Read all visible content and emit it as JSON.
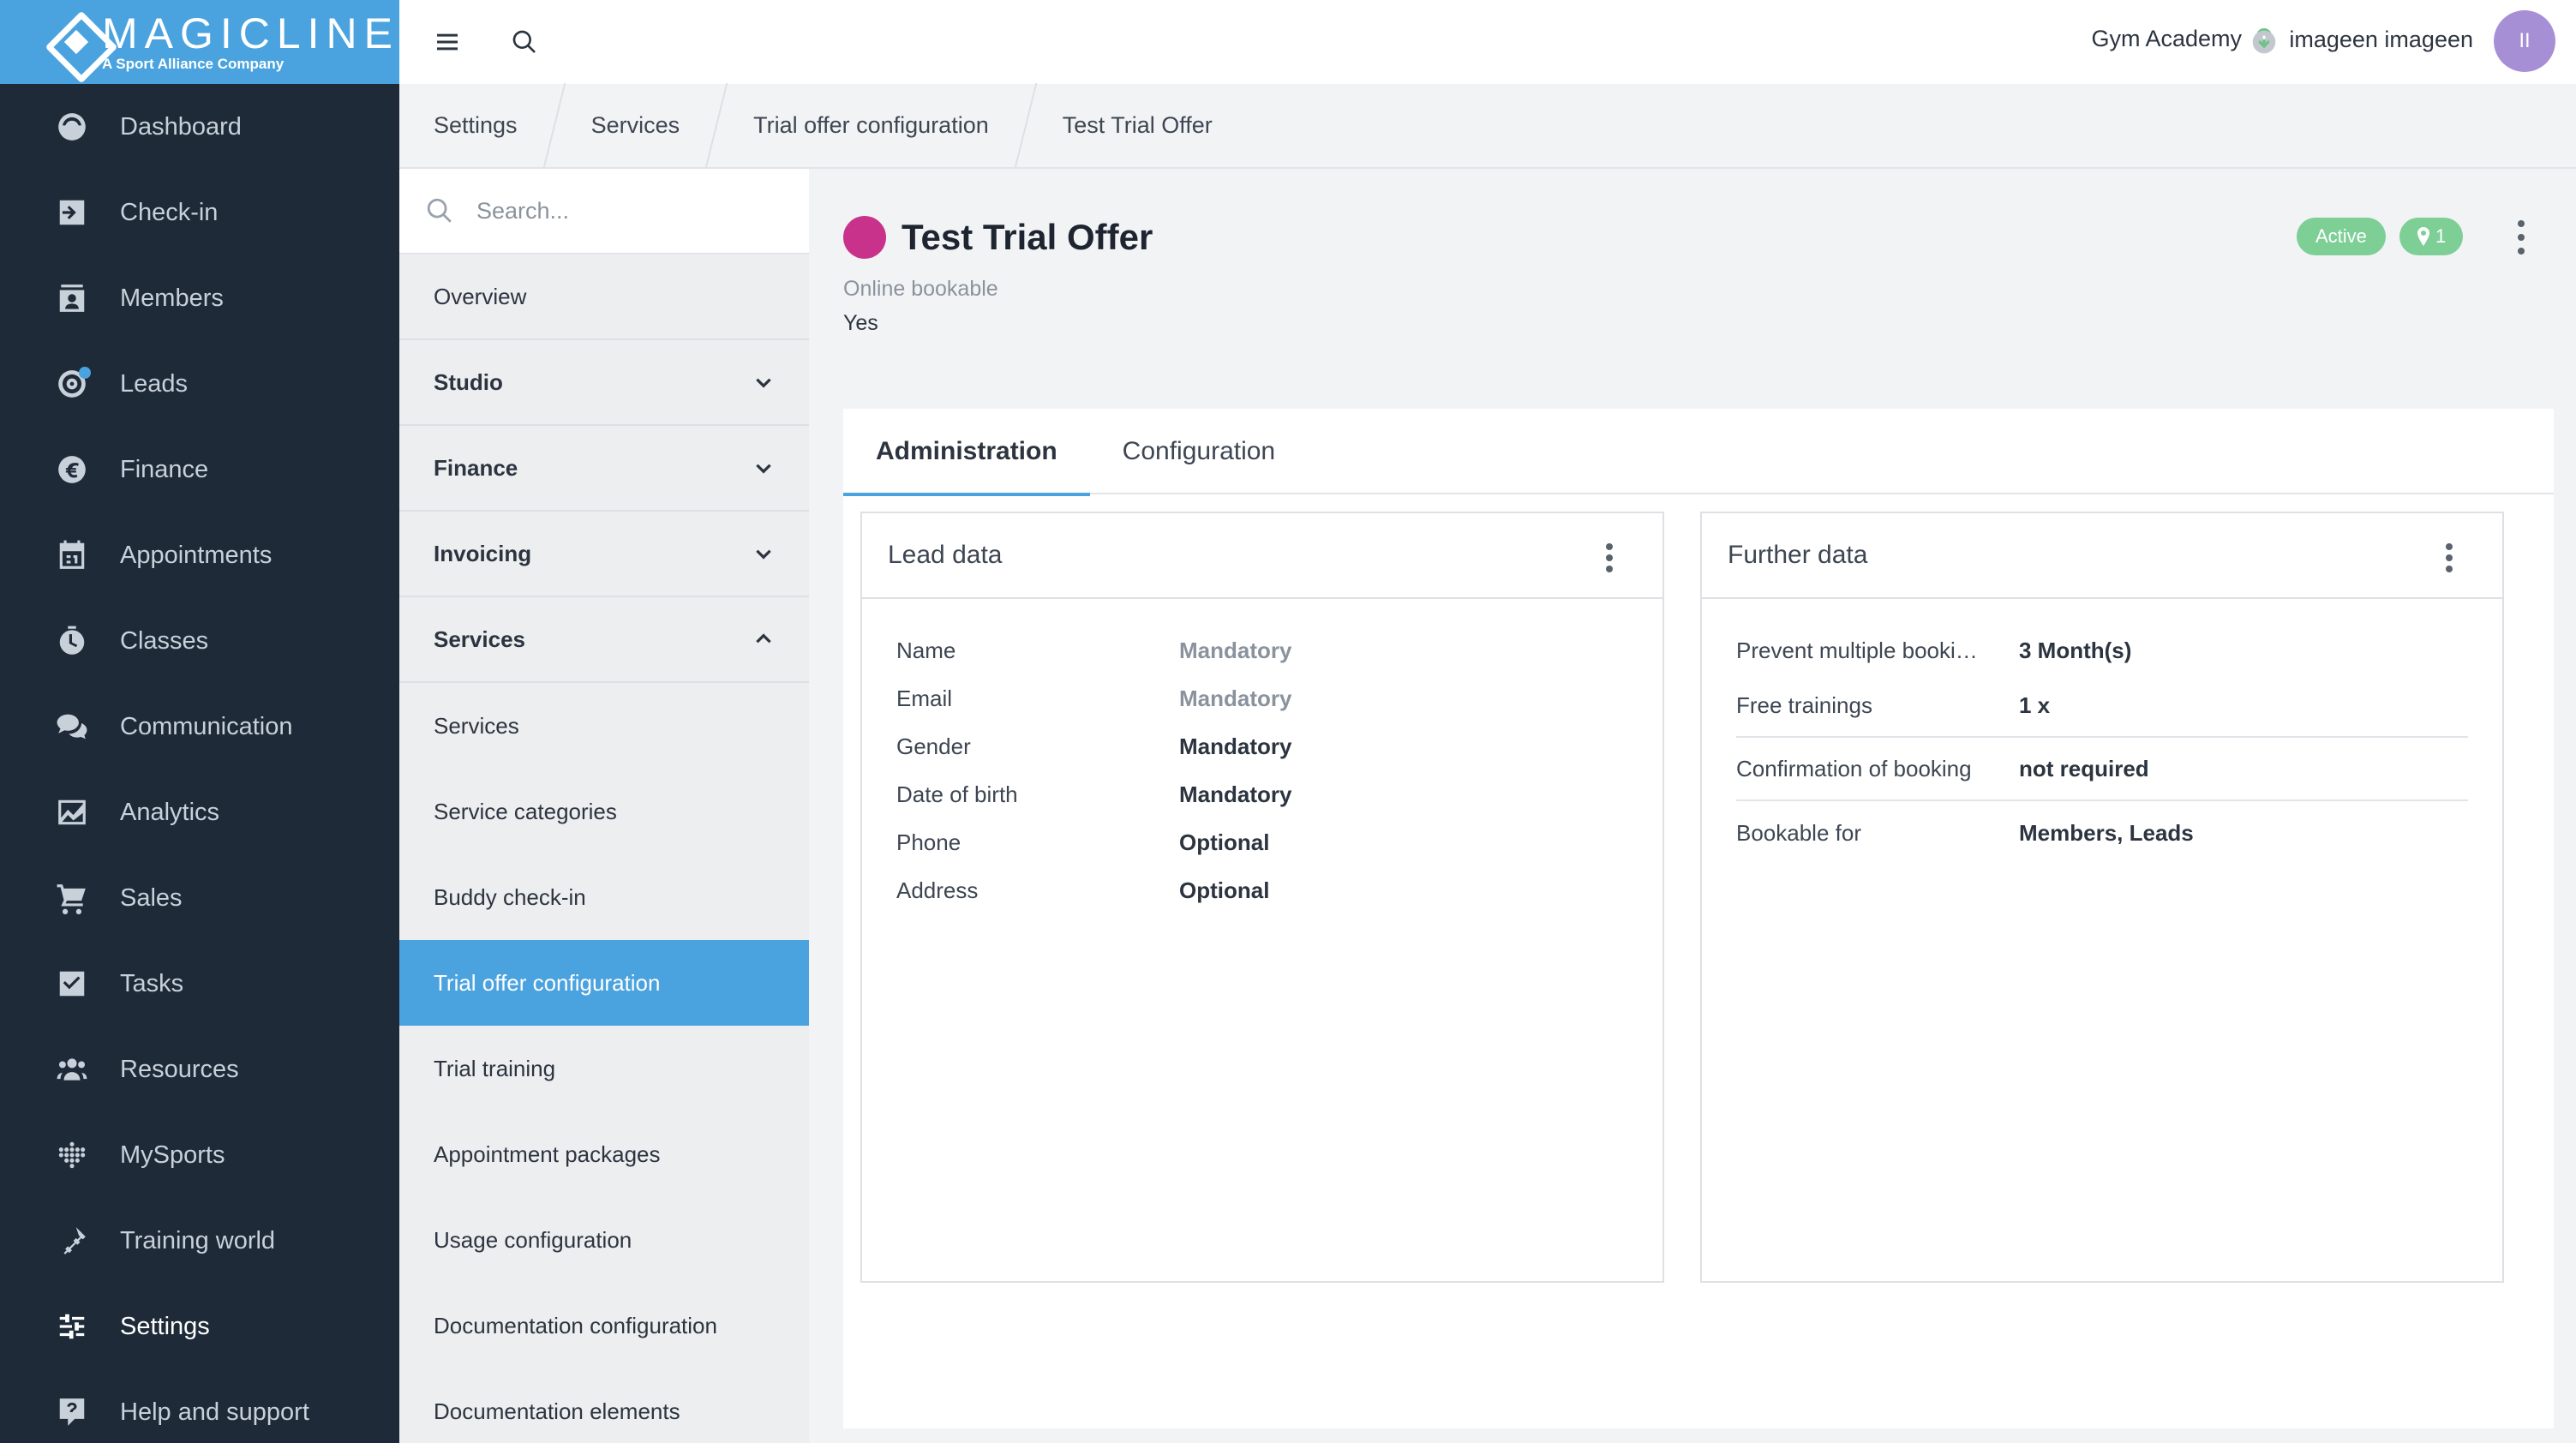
{
  "brand": {
    "name": "MAGICLINE",
    "tagline": "A Sport Alliance Company"
  },
  "nav": {
    "items": [
      {
        "label": "Dashboard",
        "icon": "dashboard-icon"
      },
      {
        "label": "Check-in",
        "icon": "check-in-icon"
      },
      {
        "label": "Members",
        "icon": "members-icon"
      },
      {
        "label": "Leads",
        "icon": "leads-icon"
      },
      {
        "label": "Finance",
        "icon": "euro-icon"
      },
      {
        "label": "Appointments",
        "icon": "calendar-icon"
      },
      {
        "label": "Classes",
        "icon": "stopwatch-icon"
      },
      {
        "label": "Communication",
        "icon": "chat-icon"
      },
      {
        "label": "Analytics",
        "icon": "chart-icon"
      },
      {
        "label": "Sales",
        "icon": "cart-icon"
      },
      {
        "label": "Tasks",
        "icon": "checkbox-icon"
      },
      {
        "label": "Resources",
        "icon": "people-icon"
      },
      {
        "label": "MySports",
        "icon": "dots-grid-icon"
      },
      {
        "label": "Training world",
        "icon": "dumbbell-icon"
      },
      {
        "label": "Settings",
        "icon": "sliders-icon"
      },
      {
        "label": "Help and support",
        "icon": "help-icon"
      }
    ]
  },
  "topbar": {
    "studio": "Gym Academy",
    "user_name": "imageen imageen",
    "avatar_initials": "II"
  },
  "breadcrumb": [
    "Settings",
    "Services",
    "Trial offer configuration",
    "Test Trial Offer"
  ],
  "submenu": {
    "search_placeholder": "Search...",
    "items": [
      {
        "label": "Overview"
      },
      {
        "label": "Studio"
      },
      {
        "label": "Finance"
      },
      {
        "label": "Invoicing"
      },
      {
        "label": "Services"
      },
      {
        "label": "Services"
      },
      {
        "label": "Service categories"
      },
      {
        "label": "Buddy check-in"
      },
      {
        "label": "Trial offer configuration"
      },
      {
        "label": "Trial training"
      },
      {
        "label": "Appointment packages"
      },
      {
        "label": "Usage configuration"
      },
      {
        "label": "Documentation configuration"
      },
      {
        "label": "Documentation elements"
      }
    ]
  },
  "offer": {
    "title": "Test Trial Offer",
    "color": "#c9328a",
    "online_bookable_label": "Online bookable",
    "online_bookable_value": "Yes",
    "status_badge": "Active",
    "location_count": "1"
  },
  "tabs": [
    "Administration",
    "Configuration"
  ],
  "lead_data": {
    "title": "Lead data",
    "rows": [
      {
        "label": "Name",
        "value": "Mandatory"
      },
      {
        "label": "Email",
        "value": "Mandatory"
      },
      {
        "label": "Gender",
        "value": "Mandatory"
      },
      {
        "label": "Date of birth",
        "value": "Mandatory"
      },
      {
        "label": "Phone",
        "value": "Optional"
      },
      {
        "label": "Address",
        "value": "Optional"
      }
    ]
  },
  "further_data": {
    "title": "Further data",
    "rows": [
      {
        "label": "Prevent multiple booki…",
        "value": "3 Month(s)"
      },
      {
        "label": "Free trainings",
        "value": "1 x"
      },
      {
        "label": "Confirmation of booking",
        "value": "not required"
      },
      {
        "label": "Bookable for",
        "value": "Members, Leads"
      }
    ]
  },
  "colors": {
    "sidebar": "#1e2a38",
    "accent": "#4aa3df",
    "badge_green": "#7dcf96"
  }
}
